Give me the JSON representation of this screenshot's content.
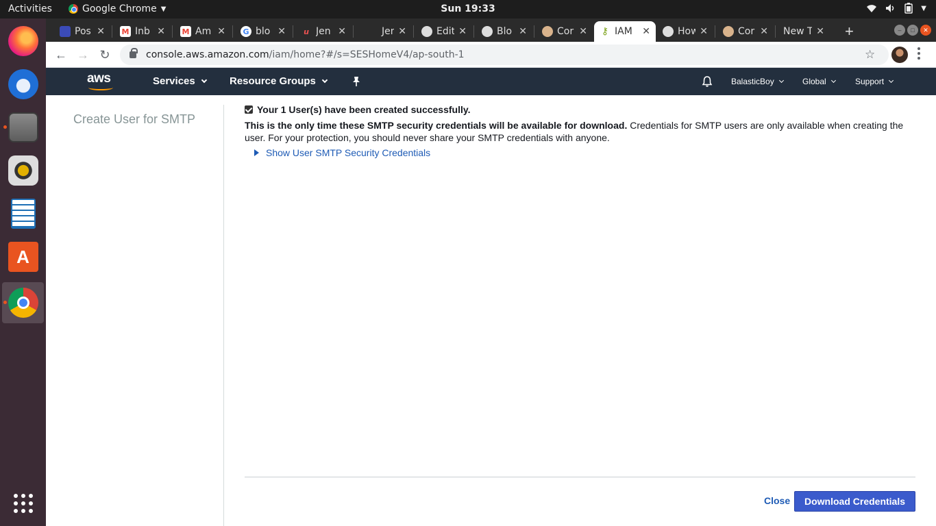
{
  "system": {
    "activities": "Activities",
    "app_name": "Google Chrome",
    "clock": "Sun 19:33"
  },
  "dock": [
    "firefox-icon",
    "thunderbird-icon",
    "files-icon",
    "rhythmbox-icon",
    "writer-icon",
    "software-center-icon",
    "chrome-icon",
    "app-grid-icon"
  ],
  "tabs": [
    {
      "title": "Pos",
      "favicon": "photos-icon",
      "color": "#3b4bb8"
    },
    {
      "title": "Inb",
      "favicon": "gmail-icon",
      "color": "#ea4335"
    },
    {
      "title": "Am",
      "favicon": "gmail-icon",
      "color": "#ea4335"
    },
    {
      "title": "blo",
      "favicon": "google-icon",
      "color": "#4285f4"
    },
    {
      "title": "Jen",
      "favicon": "udemy-icon",
      "color": "#ec5252"
    },
    {
      "title": "Jen",
      "favicon": "blank-icon",
      "color": "#2b2b2b"
    },
    {
      "title": "Edit",
      "favicon": "github-icon",
      "color": "#ffffff"
    },
    {
      "title": "Blo",
      "favicon": "github-icon",
      "color": "#ffffff"
    },
    {
      "title": "Cor",
      "favicon": "jenkins-icon",
      "color": "#d9b38c"
    },
    {
      "title": "IAM",
      "favicon": "iam-key-icon",
      "color": "#7aa116",
      "active": true
    },
    {
      "title": "How",
      "favicon": "github-icon",
      "color": "#ffffff"
    },
    {
      "title": "Cor",
      "favicon": "jenkins-icon",
      "color": "#d9b38c"
    },
    {
      "title": "New Ta",
      "favicon": "none",
      "color": "#2b2b2b"
    }
  ],
  "address": {
    "host": "console.aws.amazon.com",
    "path": "/iam/home?#/s=SESHomeV4/ap-south-1"
  },
  "aws_nav": {
    "logo": "aws",
    "services": "Services",
    "resource_groups": "Resource Groups",
    "account": "BalasticBoy",
    "region": "Global",
    "support": "Support"
  },
  "page": {
    "sidebar_title": "Create User for SMTP",
    "success_message": "Your 1 User(s) have been created successfully.",
    "notice_bold": "This is the only time these SMTP security credentials will be available for download.",
    "notice_rest": " Credentials for SMTP users are only available when creating the user. For your protection, you should never share your SMTP credentials with anyone.",
    "expander_label": "Show User SMTP Security Credentials",
    "close_label": "Close",
    "download_label": "Download Credentials"
  }
}
